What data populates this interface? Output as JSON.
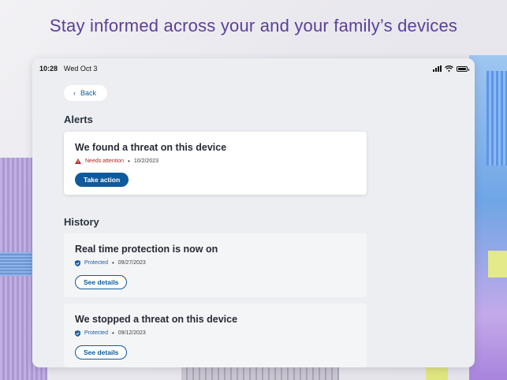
{
  "headline": "Stay informed across your and your family’s devices",
  "statusbar": {
    "time": "10:28",
    "date": "Wed Oct 3"
  },
  "back": {
    "label": "Back"
  },
  "alerts": {
    "title": "Alerts",
    "items": [
      {
        "title": "We found a threat on this device",
        "status": "Needs attention",
        "date": "10/2/2023",
        "action": "Take action"
      }
    ]
  },
  "history": {
    "title": "History",
    "items": [
      {
        "title": "Real time protection is now on",
        "status": "Protected",
        "date": "09/27/2023",
        "action": "See details"
      },
      {
        "title": "We stopped a threat on this device",
        "status": "Protected",
        "date": "09/12/2023",
        "action": "See details"
      }
    ]
  },
  "colors": {
    "accent": "#0f5a9c",
    "warning": "#b3261e",
    "headline": "#5b3f9a"
  }
}
